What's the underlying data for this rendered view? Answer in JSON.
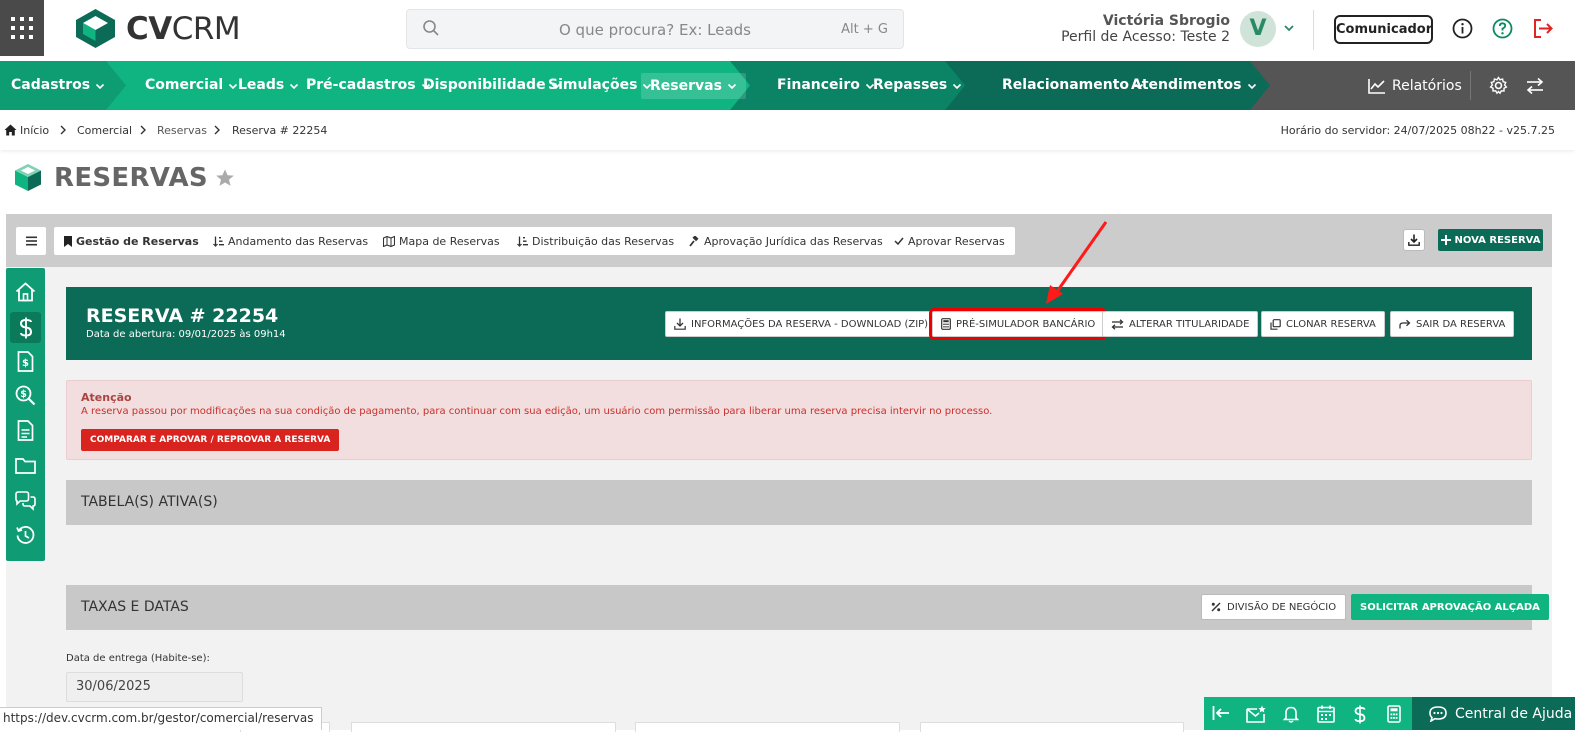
{
  "app": {
    "name_bold": "CV",
    "name_light": "CRM"
  },
  "search": {
    "placeholder": "O que procura? Ex: Leads",
    "shortcut": "Alt + G"
  },
  "user": {
    "name": "Victória Sbrogio",
    "profile": "Perfil de Acesso: Teste 2",
    "initial": "V"
  },
  "header": {
    "communicator_label": "Comunicador"
  },
  "nav": {
    "items": [
      {
        "label": "Cadastros"
      },
      {
        "label": "Comercial"
      },
      {
        "label": "Leads"
      },
      {
        "label": "Pré-cadastros"
      },
      {
        "label": "Disponibilidade"
      },
      {
        "label": "Simulações"
      },
      {
        "label": "Reservas"
      },
      {
        "label": "Financeiro"
      },
      {
        "label": "Repasses"
      },
      {
        "label": "Relacionamento"
      },
      {
        "label": "Atendimentos"
      }
    ],
    "reports_label": "Relatórios"
  },
  "breadcrumb": [
    "Início",
    "Comercial",
    "Reservas",
    "Reserva # 22254"
  ],
  "server_time": "Horário do servidor: 24/07/2025 08h22 - v25.7.25",
  "page_title": "RESERVAS",
  "tabs": [
    {
      "label": "Gestão de Reservas"
    },
    {
      "label": "Andamento das Reservas"
    },
    {
      "label": "Mapa de Reservas"
    },
    {
      "label": "Distribuição das Reservas"
    },
    {
      "label": "Aprovação Jurídica das Reservas"
    },
    {
      "label": "Aprovar Reservas"
    }
  ],
  "new_reservation_label": "NOVA RESERVA",
  "reservation": {
    "title": "RESERVA # 22254",
    "opened": "Data de abertura: 09/01/2025 às 09h14",
    "actions": [
      {
        "label": "INFORMAÇÕES DA RESERVA - DOWNLOAD (ZIP)"
      },
      {
        "label": "PRÉ-SIMULADOR BANCÁRIO"
      },
      {
        "label": "ALTERAR TITULARIDADE"
      },
      {
        "label": "CLONAR RESERVA"
      },
      {
        "label": "SAIR DA RESERVA"
      }
    ]
  },
  "alert": {
    "title": "Atenção",
    "text": "A reserva passou por modificações na sua condição de pagamento, para continuar com sua edição, um usuário com permissão para liberar uma reserva precisa intervir no processo.",
    "button": "COMPARAR E APROVAR / REPROVAR A RESERVA"
  },
  "sections": {
    "active_tables": "TABELA(S) ATIVA(S)",
    "fees_dates": "TAXAS E DATAS",
    "business_split": "DIVISÃO DE NEGÓCIO",
    "request_approval": "SOLICITAR APROVAÇÃO ALÇADA"
  },
  "fields": {
    "delivery_label": "Data de entrega (Habite-se):",
    "delivery_value": "30/06/2025"
  },
  "status_url": "https://dev.cvcrm.com.br/gestor/comercial/reservas",
  "help_label": "Central de Ajuda",
  "colors": {
    "nav_green": "#10b481",
    "dark_green": "#0c6b57",
    "alert_red": "#d9231f",
    "highlight_red": "#e00000"
  }
}
